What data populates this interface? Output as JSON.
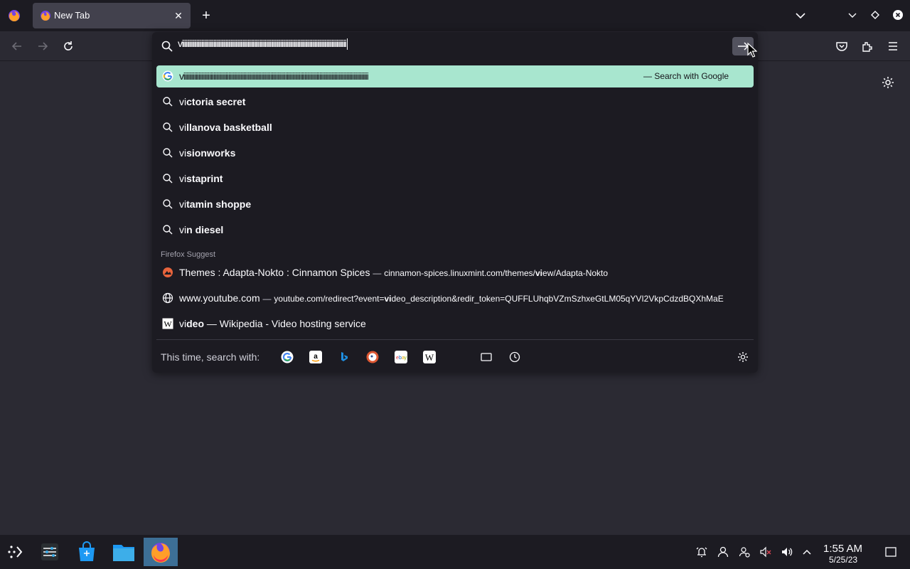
{
  "tab": {
    "title": "New Tab"
  },
  "urlbar": {
    "value": "viiiiiiiiiiiiiiiiiiiiiiiiiiiiiiiiiiiiiiiiiiiiiiiiiiiiiiiiiiiiiiiiiiiiiiiiiiiiiiiiiiiiiiiiiiiiiiiiiiiiiiiiiiiiiiiiiiiiiiiiiiiiiiiiiiiiiii"
  },
  "suggestions": {
    "heuristic": {
      "query": "viiiiiiiiiiiiiiiiiiiiiiiiiiiiiiiiiiiiiiiiiiiiiiiiiiiiiiiiiiiiiiiiiiiiiiiiiiiiiiiiiiiiiiiiiiiiiiiiiiiiiiiiiiiiiiiiiiiiiiiiiiiiiiiiiiiiiiii",
      "action": "— Search with Google"
    },
    "items": [
      {
        "typed": "vi",
        "rest": "ctoria secret"
      },
      {
        "typed": "vi",
        "rest": "llanova basketball"
      },
      {
        "typed": "vi",
        "rest": "sionworks"
      },
      {
        "typed": "vi",
        "rest": "staprint"
      },
      {
        "typed": "vi",
        "rest": "tamin shoppe"
      },
      {
        "typed": "vi",
        "rest": "n diesel"
      }
    ],
    "group_label": "Firefox Suggest",
    "firefox_suggest": [
      {
        "title": "Themes : Adapta-Nokto : Cinnamon Spices",
        "sep": "—",
        "url_pre": "cinnamon-spices.linuxmint.com/themes/",
        "url_bold": "vi",
        "url_post": "ew/Adapta-Nokto",
        "icon": "cinnamon-icon"
      },
      {
        "title": "www.youtube.com",
        "sep": "—",
        "url_pre": "youtube.com/redirect?event=",
        "url_bold": "vi",
        "url_post": "deo_description&redir_token=QUFFLUhqbVZmSzhxeGtLM05qYVI2VkpCdzdBQXhMaE",
        "icon": "globe-icon"
      },
      {
        "title_pre": "vi",
        "title_bold": "deo",
        "title_post": " — Wikipedia - Video hosting service",
        "icon": "wikipedia-icon"
      }
    ]
  },
  "footer": {
    "label": "This time, search with:",
    "engines": [
      "google-icon",
      "amazon-icon",
      "bing-icon",
      "duckduckgo-icon",
      "ebay-icon",
      "wikipedia-icon",
      "tabs-icon",
      "history-icon"
    ]
  },
  "taskbar": {
    "time": "1:55 AM",
    "date": "5/25/23"
  },
  "colors": {
    "accent": "#a8e6cf",
    "toolbar": "#2b2a33",
    "tabstrip": "#1c1b22",
    "taskbar_active": "#3d6f96"
  }
}
